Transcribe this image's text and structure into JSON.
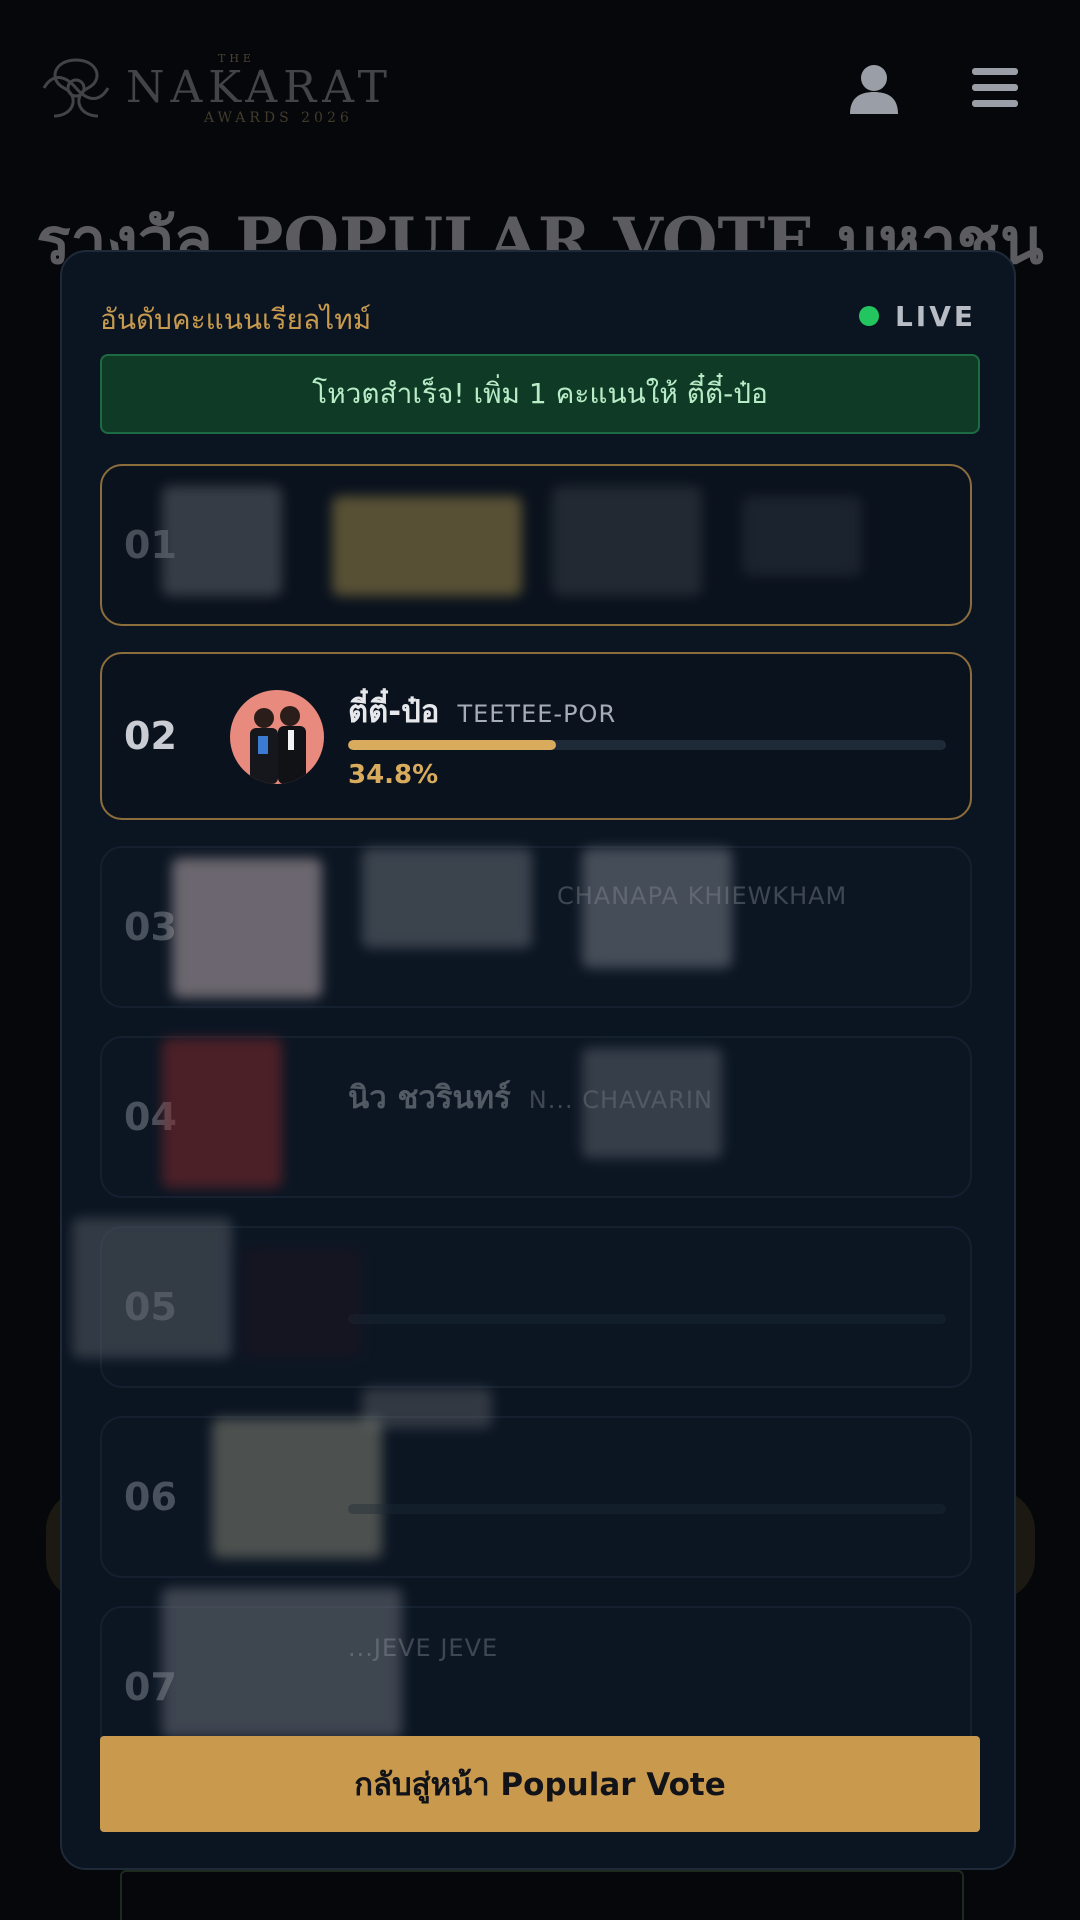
{
  "header": {
    "logo": {
      "small": "THE",
      "main": "NAKARAT",
      "sub": "AWARDS 2026"
    },
    "user_icon": "user-icon",
    "menu_icon": "menu-icon"
  },
  "background": {
    "title": "รางวัล POPULAR VOTE มหาชน"
  },
  "modal": {
    "title": "อันดับคะแนนเรียลไทม์",
    "live_label": "LIVE",
    "notice": "โหวตสำเร็จ! เพิ่ม 1 คะแนนให้ ตี๋ตี๋-ป๋อ",
    "rows": [
      {
        "rank": "01",
        "name_th": "",
        "name_en": "",
        "percent_text": "",
        "percent": 0,
        "highlight": true
      },
      {
        "rank": "02",
        "name_th": "ตี๋ตี๋-ป๋อ",
        "name_en": "TEETEE-POR",
        "percent_text": "34.8%",
        "percent": 34.8,
        "highlight": true
      },
      {
        "rank": "03",
        "name_th": "",
        "name_en": "CHANAPA KHIEWKHAM",
        "percent_text": "",
        "percent": 0,
        "highlight": false
      },
      {
        "rank": "04",
        "name_th": "นิว ชวรินทร์",
        "name_en": "N... CHAVARIN",
        "percent_text": "",
        "percent": 0,
        "highlight": false
      },
      {
        "rank": "05",
        "name_th": "",
        "name_en": "",
        "percent_text": "",
        "percent": 0,
        "highlight": false
      },
      {
        "rank": "06",
        "name_th": "",
        "name_en": "",
        "percent_text": "",
        "percent": 0,
        "highlight": false
      },
      {
        "rank": "07",
        "name_th": "",
        "name_en": "...JEVE JEVE",
        "percent_text": "",
        "percent": 0,
        "highlight": false
      }
    ],
    "back_button": "กลับสู่หน้า Popular Vote"
  },
  "colors": {
    "accent_gold": "#d8ac5c",
    "live_green": "#22c55e",
    "notice_bg": "#0f3a25",
    "modal_bg": "#0b1522"
  }
}
